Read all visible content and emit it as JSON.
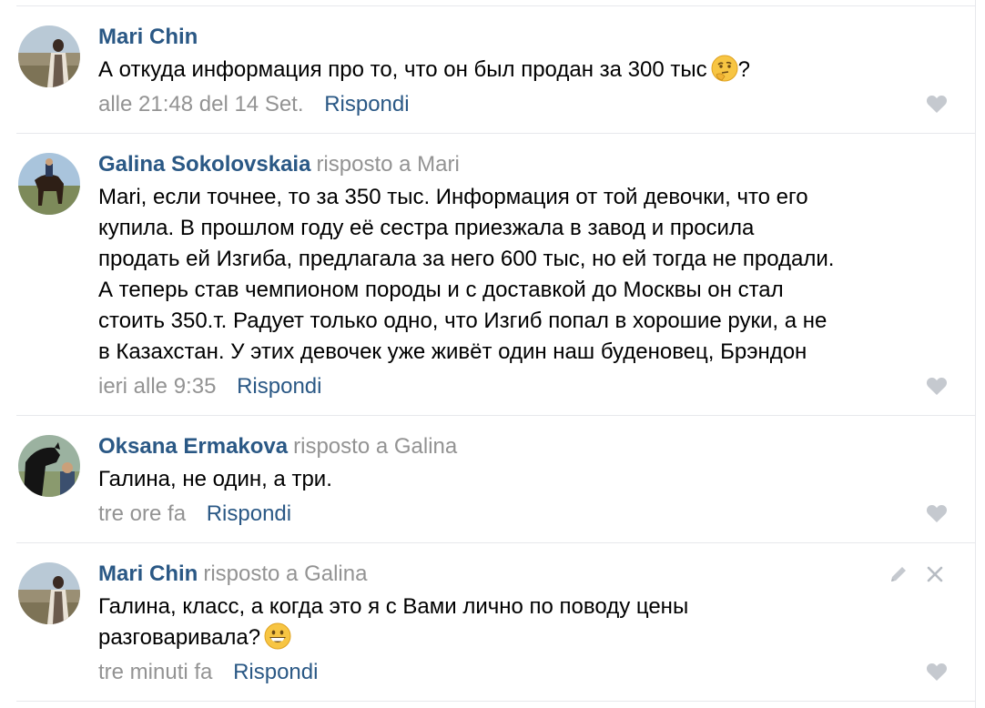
{
  "comments": [
    {
      "author": "Mari Chin",
      "reply_prefix": "",
      "reply_to": "",
      "lines": [
        "А откуда информация про то, что он был продан за 300 тыс"
      ],
      "emoji_icon": "thinking-face-emoji",
      "after_emoji": "?",
      "date": "alle 21:48 del 14 Set.",
      "reply_label": "Rispondi"
    },
    {
      "author": "Galina Sokolovskaia",
      "reply_prefix": "risposto a",
      "reply_to": "Mari",
      "lines": [
        "Mari, если точнее, то за 350 тыс. Информация от той девочки, что его",
        "купила. В прошлом году её сестра приезжала в завод и просила",
        "продать ей Изгиба, предлагала за него 600 тыс, но ей тогда не продали.",
        "А теперь став чемпионом породы и с доставкой до Москвы он стал",
        "стоить 350.т. Радует только одно, что Изгиб попал в хорошие руки, а не",
        "в Казахстан. У этих девочек уже живёт один наш буденовец, Брэндон"
      ],
      "date": "ieri alle 9:35",
      "reply_label": "Rispondi"
    },
    {
      "author": "Oksana Ermakova",
      "reply_prefix": "risposto a",
      "reply_to": "Galina",
      "lines": [
        "Галина, не один, а три."
      ],
      "date": "tre ore fa",
      "reply_label": "Rispondi"
    },
    {
      "author": "Mari Chin",
      "reply_prefix": "risposto a",
      "reply_to": "Galina",
      "lines": [
        "Галина, класс, а когда это я с Вами лично по поводу цены",
        "разговаривала?"
      ],
      "emoji_icon": "grinning-face-emoji",
      "date": "tre minuti fa",
      "reply_label": "Rispondi"
    }
  ],
  "icons": {
    "like": "heart-icon",
    "edit": "pencil-icon",
    "delete": "close-icon"
  },
  "colors": {
    "link": "#2a5885",
    "muted": "#939393",
    "separator": "#e7e8ec",
    "icon": "#c5c9cf"
  }
}
